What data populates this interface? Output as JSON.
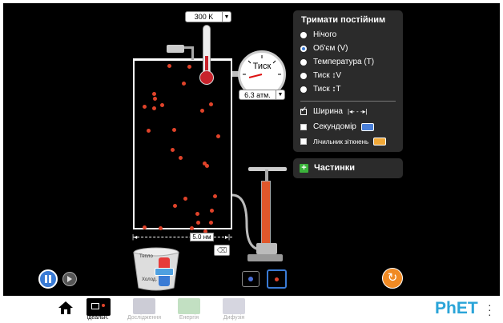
{
  "thermometer": {
    "value": "300 K"
  },
  "gauge": {
    "label": "Тиск",
    "value": "6.3 атм."
  },
  "hold_constant": {
    "title": "Тримати постійним",
    "options": [
      {
        "label": "Нічого",
        "selected": false
      },
      {
        "label": "Об'єм (V)",
        "selected": true
      },
      {
        "label": "Температура (T)",
        "selected": false
      },
      {
        "label": "Тиск ↕V",
        "selected": false
      },
      {
        "label": "Тиск ↕T",
        "selected": false
      }
    ]
  },
  "tools": {
    "width_label": "Ширина",
    "width_checked": true,
    "stopwatch_label": "Секундомір",
    "stopwatch_checked": false,
    "collision_label": "Лічильник зіткнень",
    "collision_checked": false
  },
  "particles_panel": {
    "label": "Частинки"
  },
  "width_ruler": {
    "value": "5.0 нм"
  },
  "heater": {
    "heat_label": "Тепло",
    "cool_label": "Холод."
  },
  "colors": {
    "accent_blue": "#3a7bd5",
    "particle_red": "#e0432a",
    "reset_orange": "#f08a24",
    "panel_bg": "#2b2b2b"
  },
  "nav": {
    "home_icon": "home-icon",
    "tabs": [
      {
        "label": "Ідеальн.",
        "active": true
      },
      {
        "label": "Дослідження",
        "active": false
      },
      {
        "label": "Енергія",
        "active": false
      },
      {
        "label": "Дифузія",
        "active": false
      }
    ],
    "brand": "PhET"
  }
}
